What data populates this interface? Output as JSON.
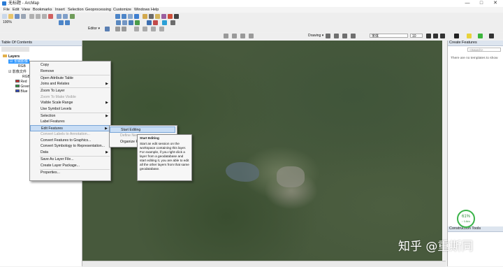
{
  "window": {
    "title": "无标题 - ArcMap",
    "minimize": "—",
    "maximize": "□",
    "close": "✕"
  },
  "menu": [
    "File",
    "Edit",
    "View",
    "Bookmarks",
    "Insert",
    "Selection",
    "Geoprocessing",
    "Customize",
    "Windows",
    "Help"
  ],
  "toolbar": {
    "scale": "1:",
    "zoom": "100%",
    "editor_label": "Editor ▾",
    "drawing_label": "Drawing ▾",
    "font_name": "宋体",
    "font_size": "10"
  },
  "toc": {
    "title": "Table Of Contents",
    "layers_root": "Layers",
    "layer1": "长城影像",
    "layer1_band": "RGB",
    "layer2": "影像文件",
    "layer2_rgb": "RGB",
    "bands": [
      {
        "label": "Red",
        "color": "#d62f2f"
      },
      {
        "label": "Green",
        "color": "#2ea043"
      },
      {
        "label": "Blue",
        "color": "#2f49c8"
      }
    ]
  },
  "context_menu": {
    "items": [
      {
        "label": "Copy",
        "state": "normal"
      },
      {
        "label": "Remove",
        "state": "normal"
      },
      {
        "label": "Open Attribute Table",
        "state": "normal"
      },
      {
        "label": "Joins and Relates",
        "state": "normal",
        "submenu": true
      },
      {
        "label": "Zoom To Layer",
        "state": "normal"
      },
      {
        "label": "Zoom To Make Visible",
        "state": "disabled"
      },
      {
        "label": "Visible Scale Range",
        "state": "normal",
        "submenu": true
      },
      {
        "label": "Use Symbol Levels",
        "state": "normal"
      },
      {
        "label": "Selection",
        "state": "normal",
        "submenu": true
      },
      {
        "label": "Label Features",
        "state": "normal"
      },
      {
        "label": "Edit Features",
        "state": "highlighted",
        "submenu": true
      },
      {
        "label": "Convert Labels to Annotation...",
        "state": "disabled"
      },
      {
        "label": "Convert Features to Graphics...",
        "state": "normal"
      },
      {
        "label": "Convert Symbology to Representation...",
        "state": "normal"
      },
      {
        "label": "Data",
        "state": "normal",
        "submenu": true
      },
      {
        "label": "Save As Layer File...",
        "state": "normal"
      },
      {
        "label": "Create Layer Package...",
        "state": "normal"
      },
      {
        "label": "Properties...",
        "state": "normal"
      }
    ]
  },
  "submenu": {
    "items": [
      {
        "label": "Start Editing",
        "state": "highlighted"
      },
      {
        "label": "Define New...",
        "state": "disabled"
      },
      {
        "label": "Organize Fe...",
        "state": "normal"
      }
    ]
  },
  "tooltip": {
    "title": "Start Editing",
    "body": "Start an edit session on the workspace containing this layer. For example, if you right-click a layer from a geodatabase and start editing it, you are able to edit all the other layers from that same geodatabase."
  },
  "create_features": {
    "title": "Create Features",
    "search_placeholder": "<Search>",
    "empty_text": "There are no templates to show",
    "construction_title": "Construction Tools"
  },
  "perf_badge": {
    "value": "61%",
    "sub": "↑ 0.4k/s"
  },
  "watermark": "知乎 @重斯同",
  "colors": {
    "accent": "#3399ff",
    "menu_highlight": "#c8ddf5",
    "map_base": "#47593c"
  }
}
